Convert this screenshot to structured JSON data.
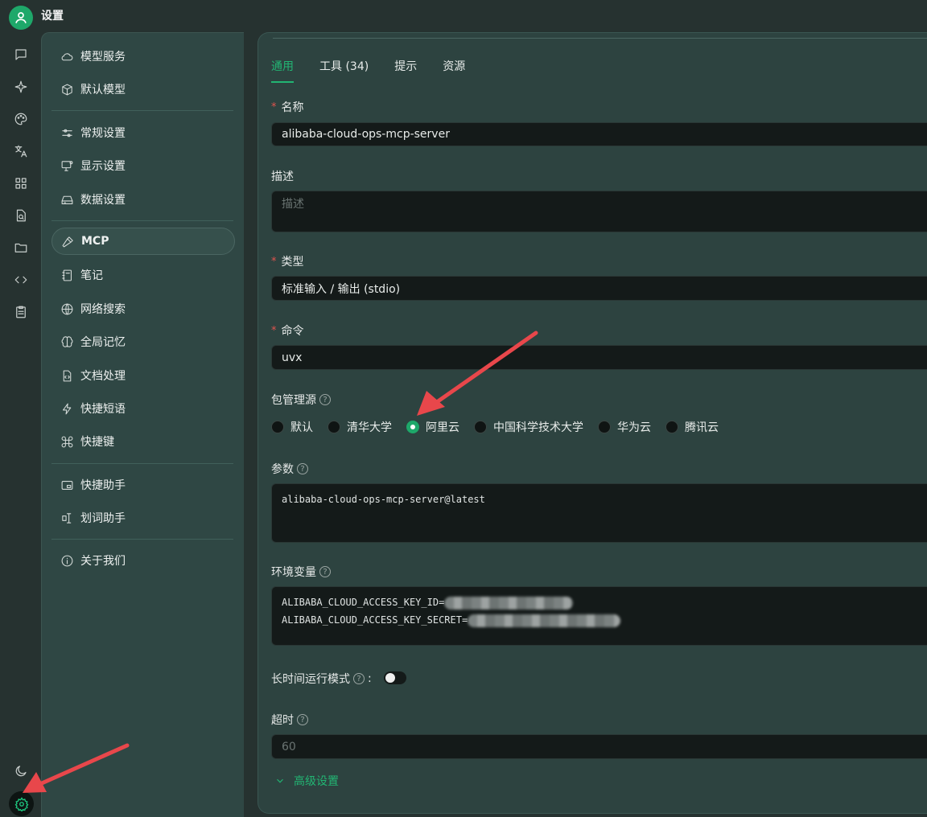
{
  "window": {
    "title": "设置"
  },
  "rail": {
    "icons": [
      "chat-icon",
      "sparkle-icon",
      "palette-icon",
      "translate-icon",
      "apps-icon",
      "file-search-icon",
      "folder-icon",
      "code-icon",
      "clipboard-icon",
      "moon-icon",
      "settings-icon"
    ]
  },
  "sidebar": {
    "items": [
      {
        "label": "模型服务",
        "icon": "cloud-icon"
      },
      {
        "label": "默认模型",
        "icon": "cube-icon"
      },
      {
        "label": "常规设置",
        "icon": "sliders-icon"
      },
      {
        "label": "显示设置",
        "icon": "monitor-icon"
      },
      {
        "label": "数据设置",
        "icon": "drive-icon"
      },
      {
        "label": "MCP",
        "icon": "hammer-icon"
      },
      {
        "label": "笔记",
        "icon": "notebook-icon"
      },
      {
        "label": "网络搜索",
        "icon": "globe-icon"
      },
      {
        "label": "全局记忆",
        "icon": "brain-icon"
      },
      {
        "label": "文档处理",
        "icon": "doc-code-icon"
      },
      {
        "label": "快捷短语",
        "icon": "bolt-icon"
      },
      {
        "label": "快捷键",
        "icon": "command-icon"
      },
      {
        "label": "快捷助手",
        "icon": "window-icon"
      },
      {
        "label": "划词助手",
        "icon": "text-cursor-icon"
      },
      {
        "label": "关于我们",
        "icon": "info-icon"
      }
    ],
    "active": "MCP"
  },
  "main": {
    "tabs": [
      {
        "label": "通用",
        "active": true
      },
      {
        "label": "工具 (34)",
        "active": false
      },
      {
        "label": "提示",
        "active": false
      },
      {
        "label": "资源",
        "active": false
      }
    ],
    "name": {
      "label": "名称",
      "value": "alibaba-cloud-ops-mcp-server"
    },
    "description": {
      "label": "描述",
      "placeholder": "描述"
    },
    "type": {
      "label": "类型",
      "value": "标准输入 / 输出 (stdio)"
    },
    "command": {
      "label": "命令",
      "value": "uvx"
    },
    "registry": {
      "label": "包管理源",
      "options": [
        "默认",
        "清华大学",
        "阿里云",
        "中国科学技术大学",
        "华为云",
        "腾讯云"
      ],
      "selected": "阿里云"
    },
    "args": {
      "label": "参数",
      "value": "alibaba-cloud-ops-mcp-server@latest"
    },
    "env": {
      "label": "环境变量",
      "line1_key": "ALIBABA_CLOUD_ACCESS_KEY_ID=",
      "line2_key": "ALIBABA_CLOUD_ACCESS_KEY_SECRET="
    },
    "long_running": {
      "label": "长时间运行模式",
      "suffix": ":",
      "enabled": false
    },
    "timeout": {
      "label": "超时",
      "placeholder": "60"
    },
    "advanced": {
      "label": "高级设置"
    }
  },
  "colors": {
    "accent": "#22b573",
    "annotation_arrow": "#e8474b"
  }
}
